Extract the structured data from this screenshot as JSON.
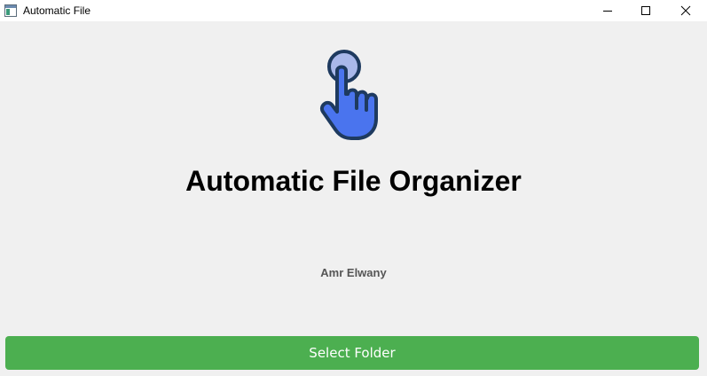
{
  "window": {
    "title": "Automatic File",
    "icons": {
      "app": "app-window-icon",
      "minimize": "minimize-icon",
      "maximize": "maximize-icon",
      "close": "close-icon"
    }
  },
  "main": {
    "icon": "pointing-hand-icon",
    "title": "Automatic File Organizer",
    "author": "Amr Elwany",
    "select_button_label": "Select Folder"
  },
  "colors": {
    "background": "#f0f0f0",
    "titlebar": "#ffffff",
    "button": "#4caf50",
    "button_text": "#ffffff",
    "hand_fill": "#4a74ee",
    "hand_outline": "#1e3a5f",
    "fingertip_circle": "#a9b8ea",
    "author_text": "#555555"
  }
}
